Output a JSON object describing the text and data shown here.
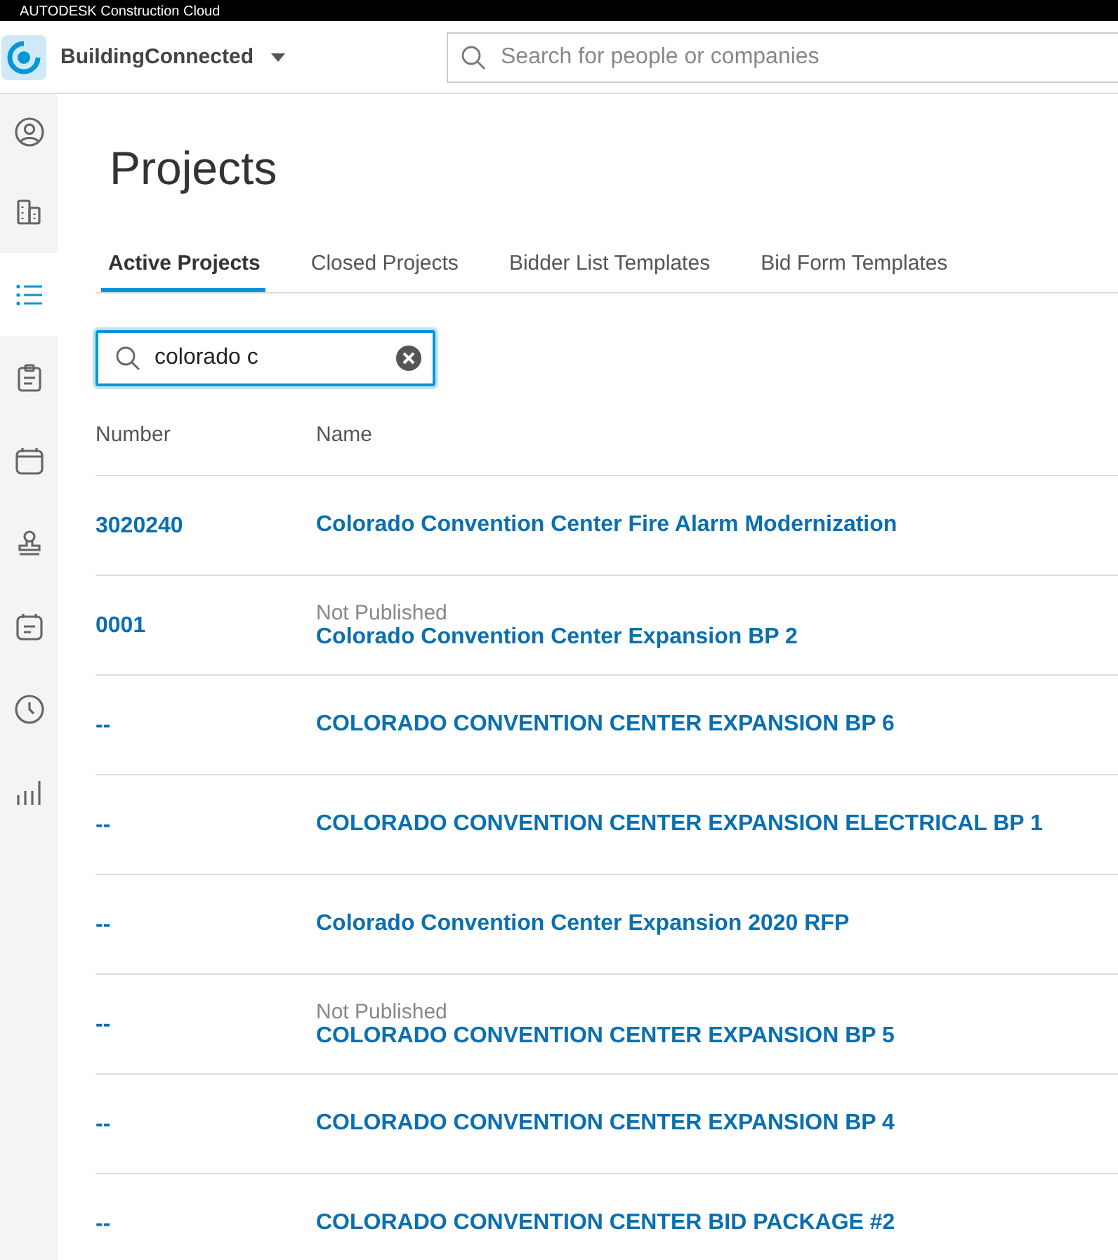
{
  "brand_bar": {
    "text": "AUTODESK Construction Cloud"
  },
  "header": {
    "app_name": "BuildingConnected",
    "search": {
      "placeholder": "Search for people or companies"
    }
  },
  "sidebar": {
    "items": [
      {
        "kind": "profile",
        "selected": false
      },
      {
        "kind": "companies",
        "selected": false
      },
      {
        "kind": "list",
        "selected": true
      },
      {
        "kind": "clipboard",
        "selected": false
      },
      {
        "kind": "calendar",
        "selected": false
      },
      {
        "kind": "stamp",
        "selected": false
      },
      {
        "kind": "schedule",
        "selected": false
      },
      {
        "kind": "clock",
        "selected": false
      },
      {
        "kind": "chart",
        "selected": false
      }
    ]
  },
  "page": {
    "title": "Projects",
    "tabs": [
      {
        "label": "Active Projects",
        "selected": true
      },
      {
        "label": "Closed Projects",
        "selected": false
      },
      {
        "label": "Bidder List Templates",
        "selected": false
      },
      {
        "label": "Bid Form Templates",
        "selected": false
      }
    ],
    "filter": {
      "value": "colorado c"
    },
    "table": {
      "columns": [
        "Number",
        "Name"
      ],
      "rows": [
        {
          "number": "3020240",
          "name": "Colorado Convention Center Fire Alarm Modernization"
        },
        {
          "number": "0001",
          "status": "Not Published",
          "name": "Colorado Convention Center Expansion BP 2"
        },
        {
          "number": "--",
          "name": "COLORADO CONVENTION CENTER EXPANSION BP 6"
        },
        {
          "number": "--",
          "name": "COLORADO CONVENTION CENTER EXPANSION ELECTRICAL BP 1"
        },
        {
          "number": "--",
          "name": "Colorado Convention Center Expansion 2020 RFP"
        },
        {
          "number": "--",
          "status": "Not Published",
          "name": "COLORADO CONVENTION CENTER EXPANSION BP 5"
        },
        {
          "number": "--",
          "name": "COLORADO CONVENTION CENTER EXPANSION BP 4"
        },
        {
          "number": "--",
          "name": "COLORADO CONVENTION CENTER BID PACKAGE #2"
        }
      ]
    }
  }
}
